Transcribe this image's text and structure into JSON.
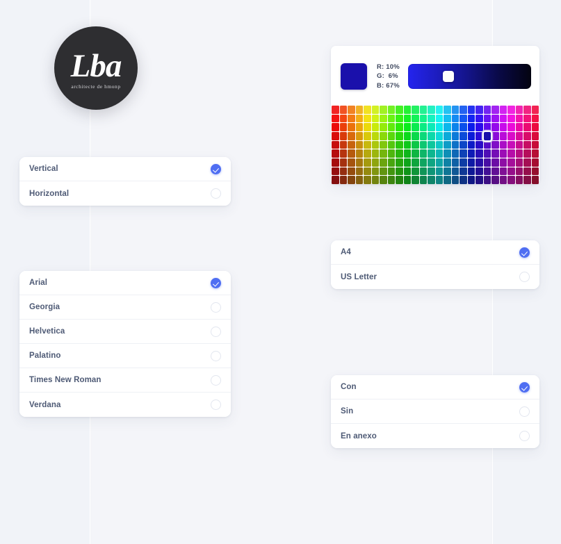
{
  "logo": {
    "word": "Lba",
    "subtitle": "architecte de hmonp"
  },
  "color_picker": {
    "swatch_color": "#1a10ab",
    "r_label": "R: 10%",
    "g_label": "G:  6%",
    "b_label": "B: 67%",
    "r_percent": 10,
    "g_percent": 6,
    "b_percent": 67,
    "slider_handle_percent": 33,
    "gradient_from": "#2424ee",
    "gradient_to": "#030310",
    "grid_columns": 26,
    "grid_rows": 9,
    "selected_column": 19,
    "selected_row": 3
  },
  "orientation": {
    "options": [
      {
        "label": "Vertical",
        "selected": true
      },
      {
        "label": "Horizontal",
        "selected": false
      }
    ]
  },
  "font": {
    "options": [
      {
        "label": "Arial",
        "selected": true
      },
      {
        "label": "Georgia",
        "selected": false
      },
      {
        "label": "Helvetica",
        "selected": false
      },
      {
        "label": "Palatino",
        "selected": false
      },
      {
        "label": "Times New Roman",
        "selected": false
      },
      {
        "label": "Verdana",
        "selected": false
      }
    ]
  },
  "paper": {
    "options": [
      {
        "label": "A4",
        "selected": true
      },
      {
        "label": "US Letter",
        "selected": false
      }
    ]
  },
  "annex": {
    "options": [
      {
        "label": "Con",
        "selected": true
      },
      {
        "label": "Sin",
        "selected": false
      },
      {
        "label": "En anexo",
        "selected": false
      }
    ]
  },
  "theme": {
    "accent": "#4f6ef2",
    "page_background": "#f1f3f8",
    "panel_background": "#f4f5f9",
    "card_background": "#ffffff",
    "text": "#4e5a75",
    "logo_background": "#2e2e31"
  }
}
